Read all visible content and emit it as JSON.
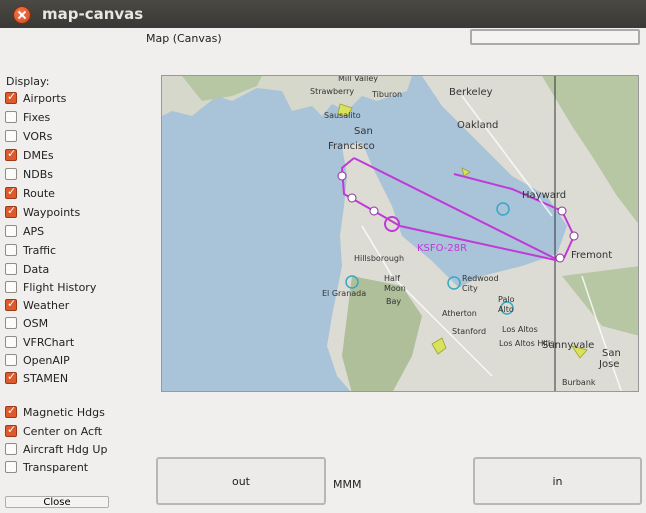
{
  "window": {
    "title": "map-canvas"
  },
  "map_label": "Map (Canvas)",
  "display": {
    "label": "Display:",
    "options": [
      {
        "label": "Airports",
        "checked": true
      },
      {
        "label": "Fixes",
        "checked": false
      },
      {
        "label": "VORs",
        "checked": false
      },
      {
        "label": "DMEs",
        "checked": true
      },
      {
        "label": "NDBs",
        "checked": false
      },
      {
        "label": "Route",
        "checked": true
      },
      {
        "label": "Waypoints",
        "checked": true
      },
      {
        "label": "APS",
        "checked": false
      },
      {
        "label": "Traffic",
        "checked": false
      },
      {
        "label": "Data",
        "checked": false
      },
      {
        "label": "Flight History",
        "checked": false
      },
      {
        "label": "Weather",
        "checked": true
      },
      {
        "label": "OSM",
        "checked": false
      },
      {
        "label": "VFRChart",
        "checked": false
      },
      {
        "label": "OpenAIP",
        "checked": false
      },
      {
        "label": "STAMEN",
        "checked": true
      }
    ],
    "extra_options": [
      {
        "label": "Magnetic Hdgs",
        "checked": true
      },
      {
        "label": "Center on Acft",
        "checked": true
      },
      {
        "label": "Aircraft Hdg Up",
        "checked": false
      },
      {
        "label": "Transparent",
        "checked": false
      }
    ]
  },
  "map": {
    "places": [
      "Mill Valley",
      "Strawberry",
      "Tiburon",
      "Berkeley",
      "Sausalito",
      "Oakland",
      "San",
      "Francisco",
      "Hayward",
      "Fremont",
      "Hillsborough",
      "Half",
      "Moon",
      "Bay",
      "El Granada",
      "Redwood",
      "City",
      "Palo",
      "Alto",
      "Atherton",
      "Los Altos",
      "Stanford",
      "Los Altos Hills",
      "Sunnyvale",
      "San",
      "Jose",
      "Burbank"
    ],
    "route_label": "KSFO-28R",
    "colors": {
      "water": "#a9c3d8",
      "land": "#dcdcd4",
      "hills": "#aebf9a",
      "route": "#c03ad6"
    }
  },
  "buttons": {
    "out": "out",
    "in": "in",
    "close": "Close"
  },
  "status_text": "MMM"
}
